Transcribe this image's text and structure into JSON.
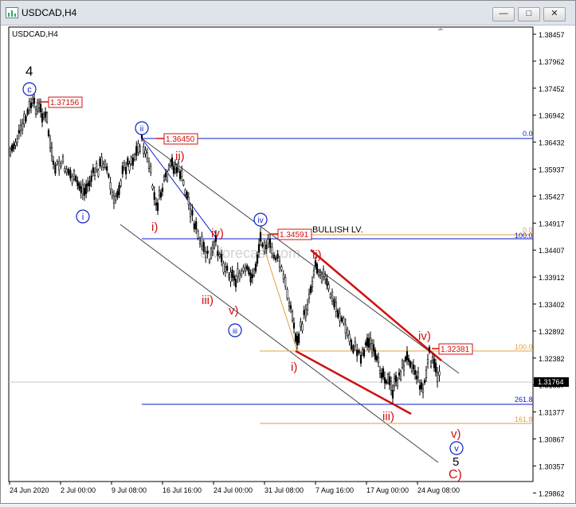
{
  "window": {
    "title": "USDCAD,H4",
    "buttons": {
      "minimize": "—",
      "maximize": "□",
      "close": "✕"
    }
  },
  "chart_label": "USDCAD,H4",
  "watermark": "ewforecast.com",
  "price_axis": [
    "1.38457",
    "1.37962",
    "1.37452",
    "1.36942",
    "1.36432",
    "1.35937",
    "1.35427",
    "1.34917",
    "1.34407",
    "1.33912",
    "1.33402",
    "1.32892",
    "1.32382",
    "1.31887",
    "1.31377",
    "1.30867",
    "1.30357",
    "1.29862"
  ],
  "current_price": "1.31764",
  "time_axis": [
    "24 Jun 2020",
    "2 Jul 00:00",
    "9 Jul 08:00",
    "16 Jul 16:00",
    "24 Jul 00:00",
    "31 Jul 08:00",
    "7 Aug 16:00",
    "17 Aug 00:00",
    "24 Aug 08:00"
  ],
  "level_tags": {
    "p1": "1.37156",
    "p2": "1.36450",
    "p3": "1.34591",
    "p4": "1.32381"
  },
  "bullish_label": "BULLISH LV.",
  "fib": {
    "blue_top": "0.0",
    "blue_bottom": "261.8",
    "orange_top": "0.0",
    "orange_mid": "100.0",
    "orange_lower": "100.0",
    "orange_bottom": "161.8"
  },
  "wave_labels": {
    "four": "4",
    "c_circle": "c",
    "i_circle": "i",
    "ii_circle": "ii",
    "iii_circle": "iii",
    "iv_circle": "iv",
    "v_circle": "v",
    "five": "5",
    "big_c": "C)",
    "r_ii": "ii)",
    "r_i": "i)",
    "r_iv": "iv)",
    "r_iii": "iii)",
    "r_v": "v)",
    "r2_ii": "ii)",
    "r2_i": "i)",
    "r2_iv": "iv)",
    "r2_iii": "iii)",
    "r2_v": "v)"
  },
  "colors": {
    "bull": "#000000",
    "blue": "#0b1ec8",
    "red": "#d01010",
    "orange": "#e0a040",
    "grid": "#c8c8c8"
  }
}
